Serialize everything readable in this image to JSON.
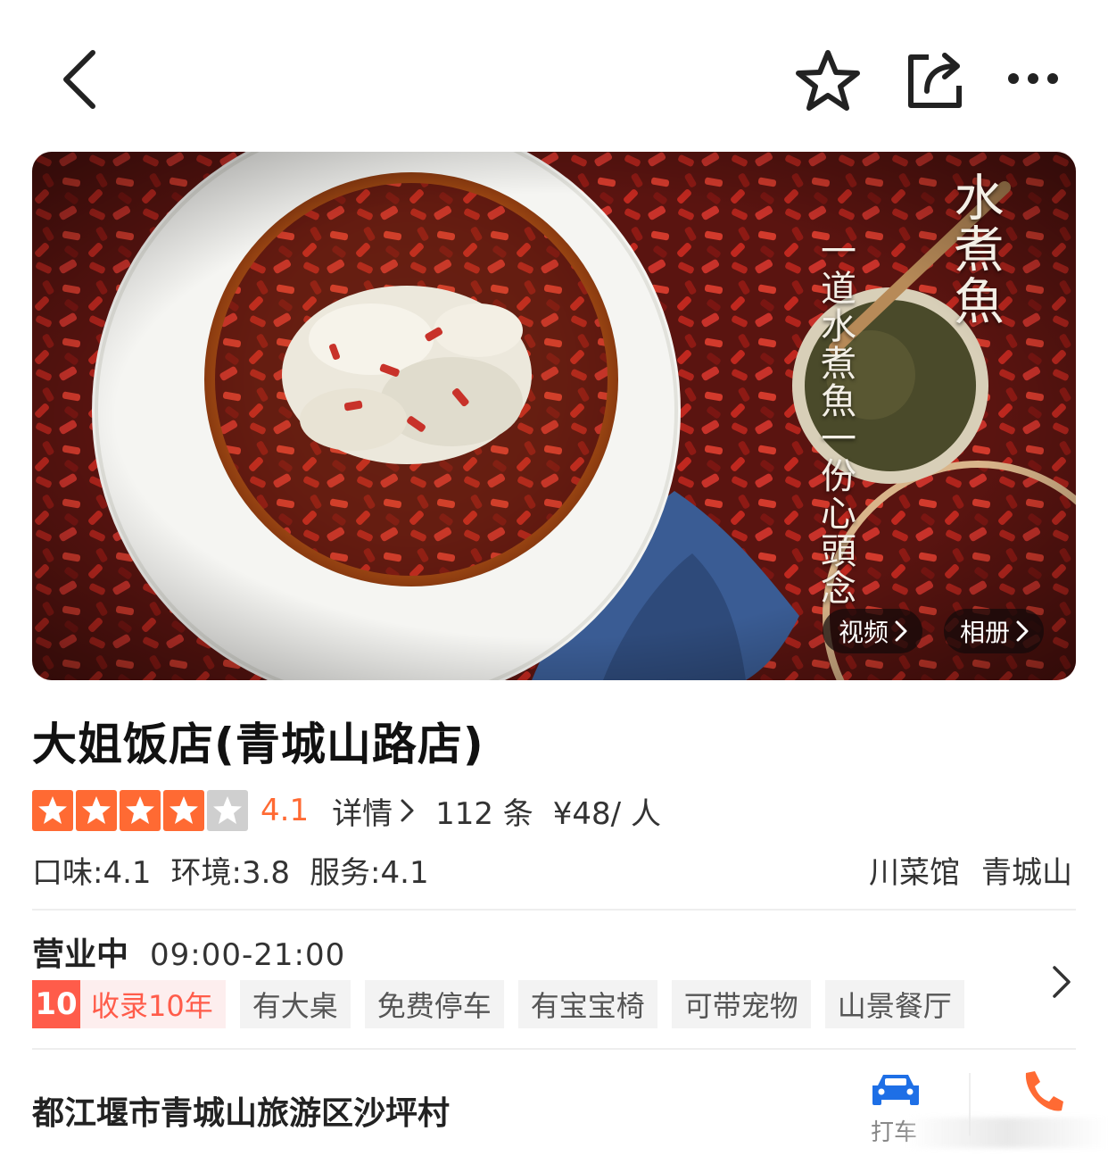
{
  "colors": {
    "accent": "#ff6a33",
    "tag_red": "#ff5c4a",
    "taxi_blue": "#1e6fe6",
    "text_dark": "#222222"
  },
  "topbar": {
    "back_icon": "chevron-left-icon",
    "favorite_icon": "star-outline-icon",
    "share_icon": "share-icon",
    "more_icon": "more-dots-icon"
  },
  "hero": {
    "overlay_title": "水煮魚",
    "overlay_subtitle": "一道水煮魚一份心頭念",
    "video_label": "视频",
    "album_label": "相册"
  },
  "shop": {
    "name": "大姐饭店(青城山路店)",
    "rating": 4.1,
    "rating_text": "4.1",
    "stars_filled": 4,
    "stars_total": 5,
    "detail_label": "详情",
    "review_count": "112 条",
    "price": "¥48/ 人",
    "scores": [
      "口味:4.1",
      "环境:3.8",
      "服务:4.1"
    ],
    "categories": [
      "川菜馆",
      "青城山"
    ]
  },
  "business": {
    "status": "营业中",
    "hours": "09:00-21:00"
  },
  "tags": {
    "years_num": "10",
    "years_text": "收录10年",
    "items": [
      "有大桌",
      "免费停车",
      "有宝宝椅",
      "可带宠物",
      "山景餐厅"
    ]
  },
  "location": {
    "address": "都江堰市青城山旅游区沙坪村",
    "taxi_label": "打车"
  }
}
